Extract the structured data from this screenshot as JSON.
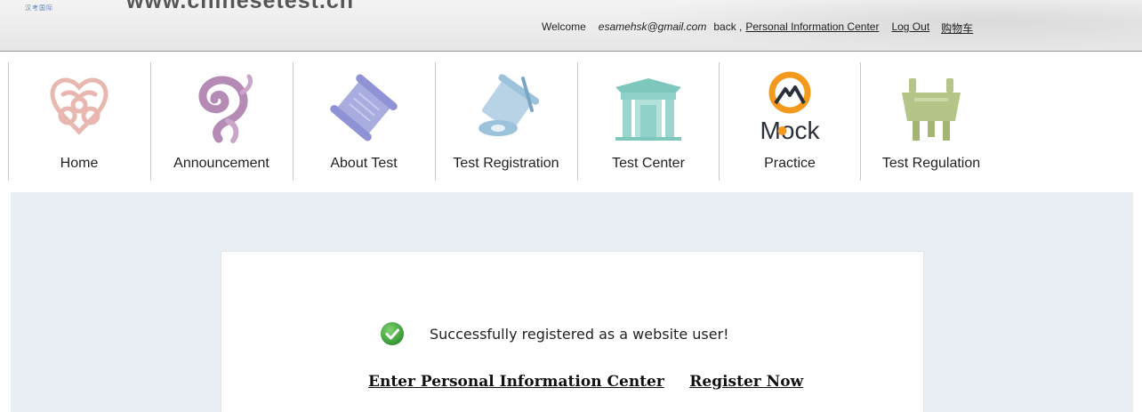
{
  "header": {
    "logo_text": "汉考国际",
    "site_url": "www.chinesetest.cn",
    "welcome": "Welcome",
    "email": "esamehsk@gmail.com",
    "back": "back ,",
    "personal_center_link": "Personal Information Center",
    "logout_link": "Log Out",
    "cart_link": "购物车"
  },
  "nav": {
    "items": [
      {
        "label": "Home",
        "icon": "ornament-heart-icon"
      },
      {
        "label": "Announcement",
        "icon": "swirl-icon"
      },
      {
        "label": "About Test",
        "icon": "scroll-icon"
      },
      {
        "label": "Test Registration",
        "icon": "scroll-brush-icon"
      },
      {
        "label": "Test Center",
        "icon": "gate-icon"
      },
      {
        "label": "Practice",
        "icon": "mock-logo-icon",
        "icon_text": "Mock"
      },
      {
        "label": "Test Regulation",
        "icon": "ding-vessel-icon"
      }
    ]
  },
  "main": {
    "message": "Successfully registered as a website user!",
    "enter_center_link": "Enter Personal Information Center",
    "register_now_link": "Register Now"
  },
  "colors": {
    "panel_bg": "#e8eef3",
    "success_green": "#3aa13a",
    "home_icon": "#e8b7b0",
    "announce_icon": "#b58ab5",
    "about_icon": "#8f93d6",
    "registration_icon": "#9cc2dc",
    "center_icon": "#8fd1c8",
    "mock_orange": "#f39a1e",
    "regulation_icon": "#b5c487"
  }
}
